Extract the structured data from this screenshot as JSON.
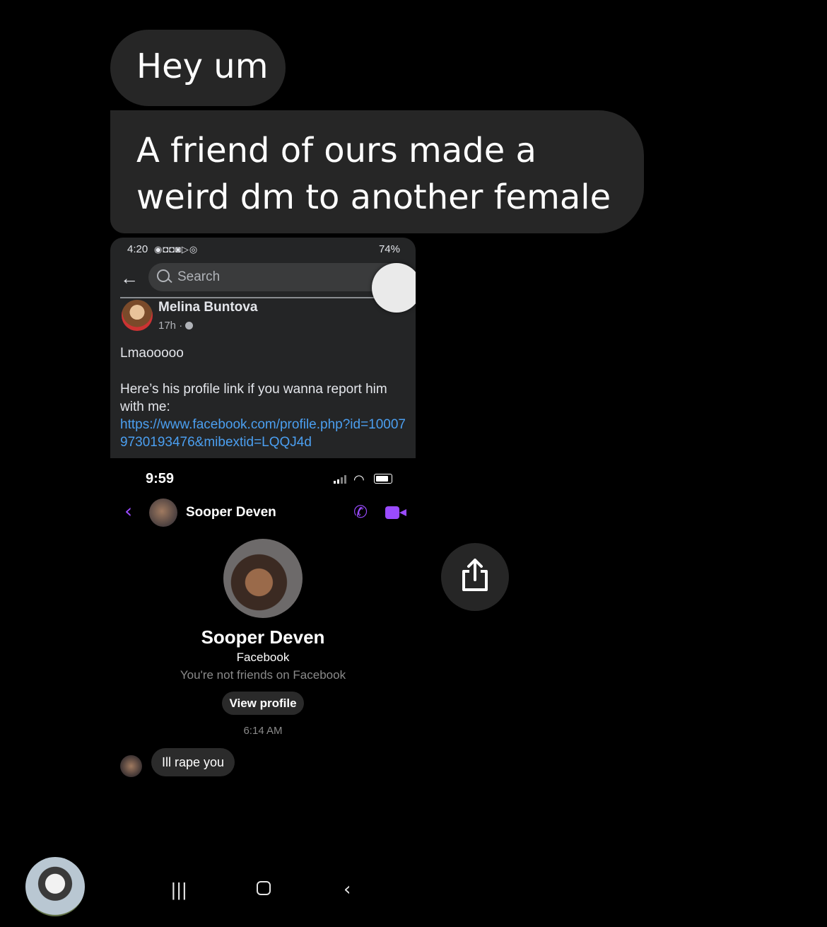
{
  "messages": [
    {
      "text": "Hey um"
    },
    {
      "text": "A friend of ours made a weird dm to another female"
    }
  ],
  "screenshot": {
    "facebook": {
      "status_time": "4:20",
      "status_battery": "74%",
      "search_placeholder": "Search",
      "post_author": "Melina Buntova",
      "post_age": "17h ·",
      "post_line1": "Lmaooooo",
      "post_line2": "Here’s his profile link if you wanna report him with me:",
      "post_link": "https://www.facebook.com/profile.php?id=100079730193476&mibextid=LQQJ4d"
    },
    "messenger": {
      "status_time": "9:59",
      "header_name": "Sooper Deven",
      "profile_name": "Sooper Deven",
      "profile_source": "Facebook",
      "friend_status": "You're not friends on Facebook",
      "view_profile_label": "View profile",
      "timestamp": "6:14 AM",
      "message": "Ill rape you"
    },
    "nav": {
      "recent": "|||",
      "back": "‹"
    }
  }
}
